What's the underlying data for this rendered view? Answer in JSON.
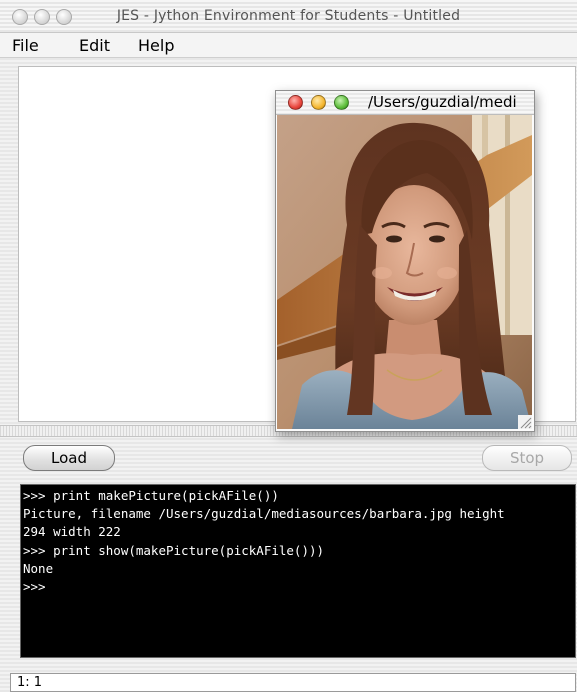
{
  "window": {
    "title": "JES - Jython Environment for Students - Untitled"
  },
  "menubar": {
    "items": [
      {
        "label": "File"
      },
      {
        "label": "Edit"
      },
      {
        "label": "Help"
      }
    ]
  },
  "buttons": {
    "load_label": "Load",
    "stop_label": "Stop"
  },
  "console": {
    "lines": [
      ">>> print makePicture(pickAFile())",
      "Picture, filename /Users/guzdial/mediasources/barbara.jpg height",
      "294 width 222",
      ">>> print show(makePicture(pickAFile()))",
      "None",
      ">>>"
    ]
  },
  "statusbar": {
    "position": "1: 1"
  },
  "picture_window": {
    "title": "/Users/guzdial/medi",
    "controls": {
      "close_color": "#e8453c",
      "minimize_color": "#f5b731",
      "zoom_color": "#5cbd3a"
    }
  },
  "colors": {
    "console_bg": "#000000",
    "console_fg": "#ffffff"
  }
}
